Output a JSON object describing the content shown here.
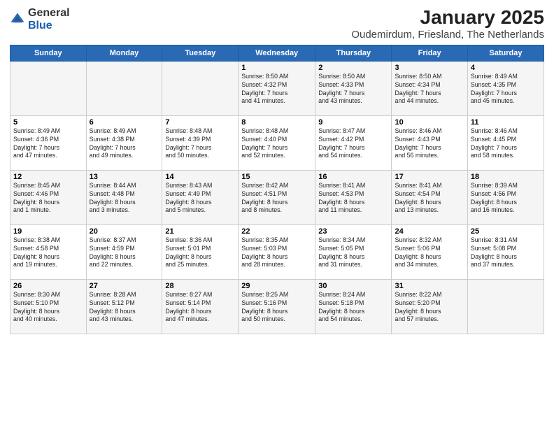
{
  "logo": {
    "general": "General",
    "blue": "Blue"
  },
  "title": "January 2025",
  "subtitle": "Oudemirdum, Friesland, The Netherlands",
  "headers": [
    "Sunday",
    "Monday",
    "Tuesday",
    "Wednesday",
    "Thursday",
    "Friday",
    "Saturday"
  ],
  "weeks": [
    [
      {
        "day": "",
        "info": ""
      },
      {
        "day": "",
        "info": ""
      },
      {
        "day": "",
        "info": ""
      },
      {
        "day": "1",
        "info": "Sunrise: 8:50 AM\nSunset: 4:32 PM\nDaylight: 7 hours\nand 41 minutes."
      },
      {
        "day": "2",
        "info": "Sunrise: 8:50 AM\nSunset: 4:33 PM\nDaylight: 7 hours\nand 43 minutes."
      },
      {
        "day": "3",
        "info": "Sunrise: 8:50 AM\nSunset: 4:34 PM\nDaylight: 7 hours\nand 44 minutes."
      },
      {
        "day": "4",
        "info": "Sunrise: 8:49 AM\nSunset: 4:35 PM\nDaylight: 7 hours\nand 45 minutes."
      }
    ],
    [
      {
        "day": "5",
        "info": "Sunrise: 8:49 AM\nSunset: 4:36 PM\nDaylight: 7 hours\nand 47 minutes."
      },
      {
        "day": "6",
        "info": "Sunrise: 8:49 AM\nSunset: 4:38 PM\nDaylight: 7 hours\nand 49 minutes."
      },
      {
        "day": "7",
        "info": "Sunrise: 8:48 AM\nSunset: 4:39 PM\nDaylight: 7 hours\nand 50 minutes."
      },
      {
        "day": "8",
        "info": "Sunrise: 8:48 AM\nSunset: 4:40 PM\nDaylight: 7 hours\nand 52 minutes."
      },
      {
        "day": "9",
        "info": "Sunrise: 8:47 AM\nSunset: 4:42 PM\nDaylight: 7 hours\nand 54 minutes."
      },
      {
        "day": "10",
        "info": "Sunrise: 8:46 AM\nSunset: 4:43 PM\nDaylight: 7 hours\nand 56 minutes."
      },
      {
        "day": "11",
        "info": "Sunrise: 8:46 AM\nSunset: 4:45 PM\nDaylight: 7 hours\nand 58 minutes."
      }
    ],
    [
      {
        "day": "12",
        "info": "Sunrise: 8:45 AM\nSunset: 4:46 PM\nDaylight: 8 hours\nand 1 minute."
      },
      {
        "day": "13",
        "info": "Sunrise: 8:44 AM\nSunset: 4:48 PM\nDaylight: 8 hours\nand 3 minutes."
      },
      {
        "day": "14",
        "info": "Sunrise: 8:43 AM\nSunset: 4:49 PM\nDaylight: 8 hours\nand 5 minutes."
      },
      {
        "day": "15",
        "info": "Sunrise: 8:42 AM\nSunset: 4:51 PM\nDaylight: 8 hours\nand 8 minutes."
      },
      {
        "day": "16",
        "info": "Sunrise: 8:41 AM\nSunset: 4:53 PM\nDaylight: 8 hours\nand 11 minutes."
      },
      {
        "day": "17",
        "info": "Sunrise: 8:41 AM\nSunset: 4:54 PM\nDaylight: 8 hours\nand 13 minutes."
      },
      {
        "day": "18",
        "info": "Sunrise: 8:39 AM\nSunset: 4:56 PM\nDaylight: 8 hours\nand 16 minutes."
      }
    ],
    [
      {
        "day": "19",
        "info": "Sunrise: 8:38 AM\nSunset: 4:58 PM\nDaylight: 8 hours\nand 19 minutes."
      },
      {
        "day": "20",
        "info": "Sunrise: 8:37 AM\nSunset: 4:59 PM\nDaylight: 8 hours\nand 22 minutes."
      },
      {
        "day": "21",
        "info": "Sunrise: 8:36 AM\nSunset: 5:01 PM\nDaylight: 8 hours\nand 25 minutes."
      },
      {
        "day": "22",
        "info": "Sunrise: 8:35 AM\nSunset: 5:03 PM\nDaylight: 8 hours\nand 28 minutes."
      },
      {
        "day": "23",
        "info": "Sunrise: 8:34 AM\nSunset: 5:05 PM\nDaylight: 8 hours\nand 31 minutes."
      },
      {
        "day": "24",
        "info": "Sunrise: 8:32 AM\nSunset: 5:06 PM\nDaylight: 8 hours\nand 34 minutes."
      },
      {
        "day": "25",
        "info": "Sunrise: 8:31 AM\nSunset: 5:08 PM\nDaylight: 8 hours\nand 37 minutes."
      }
    ],
    [
      {
        "day": "26",
        "info": "Sunrise: 8:30 AM\nSunset: 5:10 PM\nDaylight: 8 hours\nand 40 minutes."
      },
      {
        "day": "27",
        "info": "Sunrise: 8:28 AM\nSunset: 5:12 PM\nDaylight: 8 hours\nand 43 minutes."
      },
      {
        "day": "28",
        "info": "Sunrise: 8:27 AM\nSunset: 5:14 PM\nDaylight: 8 hours\nand 47 minutes."
      },
      {
        "day": "29",
        "info": "Sunrise: 8:25 AM\nSunset: 5:16 PM\nDaylight: 8 hours\nand 50 minutes."
      },
      {
        "day": "30",
        "info": "Sunrise: 8:24 AM\nSunset: 5:18 PM\nDaylight: 8 hours\nand 54 minutes."
      },
      {
        "day": "31",
        "info": "Sunrise: 8:22 AM\nSunset: 5:20 PM\nDaylight: 8 hours\nand 57 minutes."
      },
      {
        "day": "",
        "info": ""
      }
    ]
  ]
}
